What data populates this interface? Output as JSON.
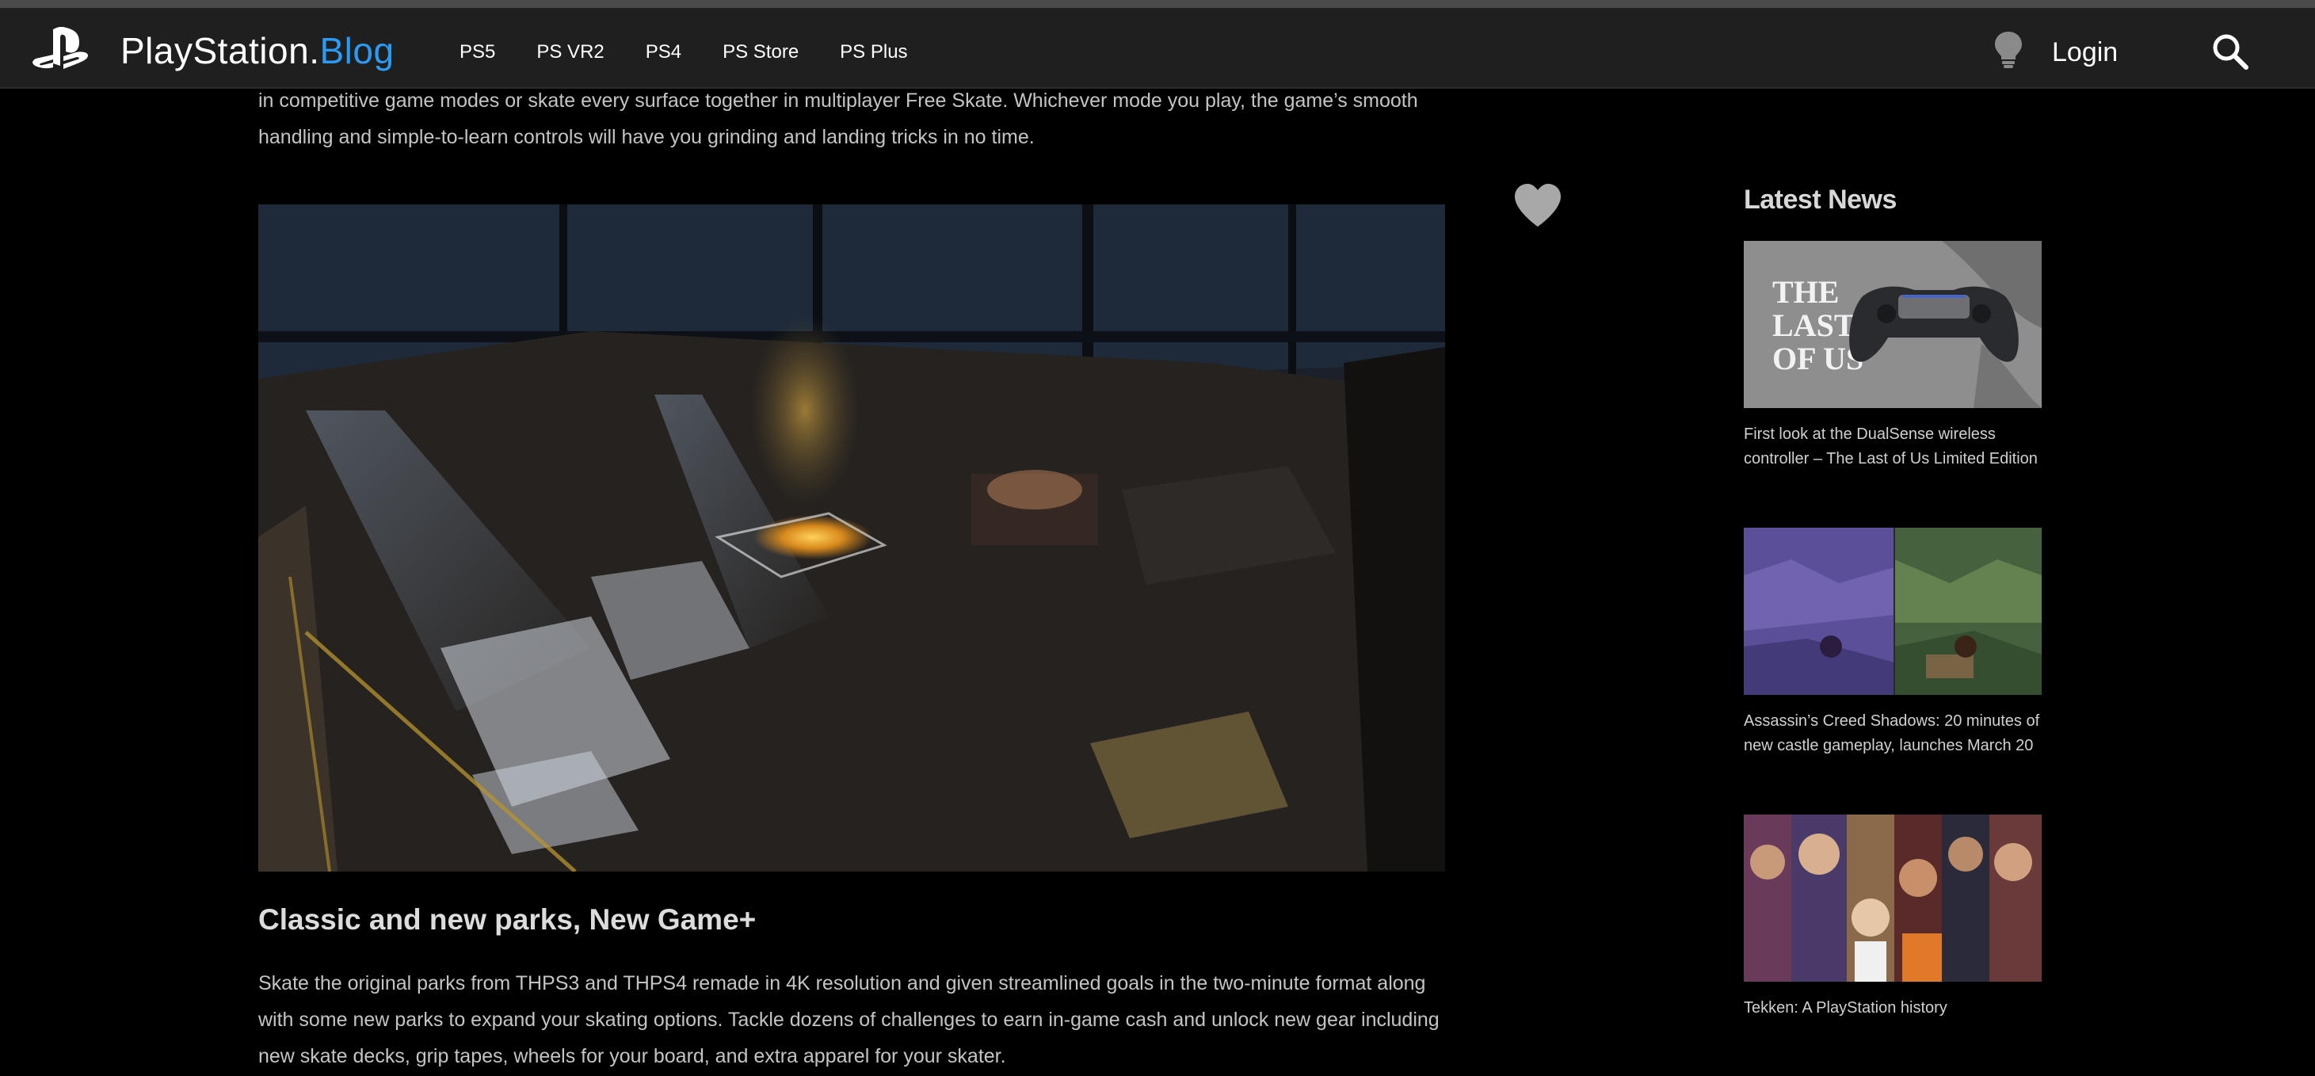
{
  "header": {
    "brand_main": "PlayStation",
    "brand_dot": ".",
    "brand_accent": "Blog",
    "nav": [
      {
        "label": "PS5"
      },
      {
        "label": "PS VR2"
      },
      {
        "label": "PS4"
      },
      {
        "label": "PS Store"
      },
      {
        "label": "PS Plus"
      }
    ],
    "login_label": "Login",
    "icons": {
      "logo": "playstation-logo-icon",
      "theme": "lightbulb-icon",
      "search": "search-icon"
    }
  },
  "article": {
    "intro_text": "in competitive game modes or skate every surface together in multiplayer Free Skate. Whichever mode you play, the game’s smooth handling and simple-to-learn controls will have you grinding and landing tricks in no time.",
    "section_title": "Classic and new parks, New Game+",
    "body_text": "Skate the original parks from THPS3 and THPS4 remade in 4K resolution and given streamlined goals in the two-minute format along with some new parks to expand your skating options. Tackle dozens of challenges to earn in-game cash and unlock new gear including new skate decks, grip tapes, wheels for your board, and extra apparel for your skater.",
    "like_icon": "heart-icon"
  },
  "sidebar": {
    "title": "Latest News",
    "items": [
      {
        "caption": "First look at the DualSense wireless controller – The Last of Us Limited Edition",
        "thumb_text": [
          "THE",
          "LAST",
          "OF US"
        ]
      },
      {
        "caption": "Assassin’s Creed Shadows: 20 minutes of new castle gameplay, launches March 20"
      },
      {
        "caption": "Tekken: A PlayStation history"
      }
    ]
  },
  "colors": {
    "background": "#000000",
    "navbar": "#1f1f1f",
    "accent": "#2b9af3",
    "text": "#c4c4c4"
  }
}
